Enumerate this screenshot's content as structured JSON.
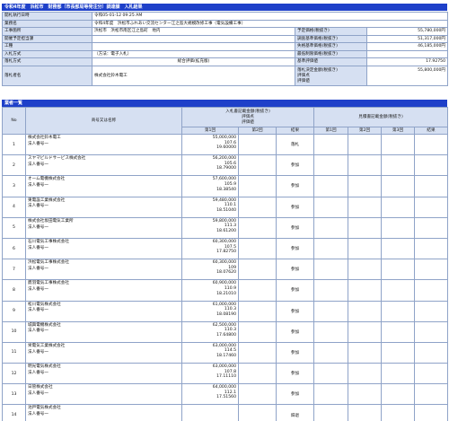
{
  "header": {
    "title": "令和4年度　浜松市　財務部（市長部局等発注分）調達課　入札結果"
  },
  "info": {
    "rows": [
      {
        "label": "開札執行日時",
        "value": "令和05-01-12 09:25 AM"
      },
      {
        "label": "業務名",
        "value": "令和4年度　浜松市ふれあい交流センター江之島大規模改修工事（電気設備工事）"
      }
    ],
    "location_label": "工事箇所",
    "location_value": "浜松市　浜松市南区江之島町　地内",
    "scheduled_label": "予定価格(税抜き)",
    "scheduled_value": "55,780,000円",
    "dept_label": "開催予定担当課",
    "survey_label": "調査基準価格(税抜き)",
    "survey_value": "51,317,000円",
    "work_label": "工種",
    "lowlimit_label": "失格基準価格(税抜き)",
    "lowlimit_value": "46,185,000円",
    "method_label": "入札方式",
    "method_value": "（方法：電子入札）",
    "minlimit_label": "最低制限価格(税抜き)",
    "minlimit_value": "",
    "rakusatsu_method_label": "落札方式",
    "rakusatsu_method_value": "総合評価(拡充版)",
    "base_score_label": "基準評価値",
    "base_score_value": "17.92750",
    "winner_label": "落札者名",
    "winner_value": "株式会社鈴木電工",
    "winner_price_label": "落札決定金額(税抜き)",
    "winner_price_sub1": "評価点",
    "winner_price_sub2": "評価値",
    "winner_price_value": "55,800,000円"
  },
  "bidders_section": {
    "title": "業者一覧",
    "col_no": "No",
    "col_name": "商号又は名称",
    "col_group1": "入札書記載金額(税抜き)",
    "col_group1_sub1": "評価点",
    "col_group1_sub2": "評価値",
    "col_group2": "見積書記載金額(税抜き)",
    "round1": "第1回",
    "round2": "第2回",
    "round3": "第3回",
    "result": "結果",
    "rows": [
      {
        "no": "1",
        "name": "株式会社鈴木電工",
        "sub": "法人番号一",
        "amount": "55,000,000",
        "score": "107.6",
        "value": "19.60000",
        "result": "落札"
      },
      {
        "no": "2",
        "name": "スヤマビルドサービス株式会社",
        "sub": "法人番号一",
        "amount": "56,200,000",
        "score": "105.6",
        "value": "18.79000",
        "result": "参加"
      },
      {
        "no": "3",
        "name": "オーム電機株式会社",
        "sub": "法人番号一",
        "amount": "57,600,000",
        "score": "105.9",
        "value": "18.38540",
        "result": "参加"
      },
      {
        "no": "4",
        "name": "東電設工業株式会社",
        "sub": "法人番号一",
        "amount": "59,480,000",
        "score": "110.1",
        "value": "18.51040",
        "result": "参加"
      },
      {
        "no": "5",
        "name": "株式会社坂田電気工業所",
        "sub": "法人番号一",
        "amount": "59,800,000",
        "score": "111.3",
        "value": "18.61200",
        "result": "参加"
      },
      {
        "no": "6",
        "name": "石川電気工事株式会社",
        "sub": "法人番号一",
        "amount": "60,300,000",
        "score": "107.5",
        "value": "17.82750",
        "result": "参加"
      },
      {
        "no": "7",
        "name": "浜松電気工事株式会社",
        "sub": "法人番号一",
        "amount": "60,300,000",
        "score": "109",
        "value": "18.07620",
        "result": "参加"
      },
      {
        "no": "8",
        "name": "鷹羽電気工事株式会社",
        "sub": "法人番号一",
        "amount": "60,900,000",
        "score": "110.9",
        "value": "18.21010",
        "result": "参加"
      },
      {
        "no": "9",
        "name": "松川電気株式会社",
        "sub": "法人番号一",
        "amount": "61,000,000",
        "score": "110.3",
        "value": "18.08190",
        "result": "参加"
      },
      {
        "no": "10",
        "name": "城興電機株式会社",
        "sub": "法人番号一",
        "amount": "62,500,000",
        "score": "110.3",
        "value": "17.64800",
        "result": "参加"
      },
      {
        "no": "11",
        "name": "栄電気工業株式会社",
        "sub": "法人番号一",
        "amount": "63,000,000",
        "score": "114.5",
        "value": "18.17460",
        "result": "参加"
      },
      {
        "no": "12",
        "name": "明光電気株式会社",
        "sub": "法人番号一",
        "amount": "63,000,000",
        "score": "107.8",
        "value": "17.11110",
        "result": "参加"
      },
      {
        "no": "13",
        "name": "日管株式会社",
        "sub": "法人番号一",
        "amount": "64,000,000",
        "score": "112.1",
        "value": "17.51560",
        "result": "参加"
      },
      {
        "no": "14",
        "name": "池戸電気株式会社",
        "sub": "法人番号一",
        "amount": "",
        "score": "",
        "value": "",
        "result": "辞退"
      }
    ]
  }
}
